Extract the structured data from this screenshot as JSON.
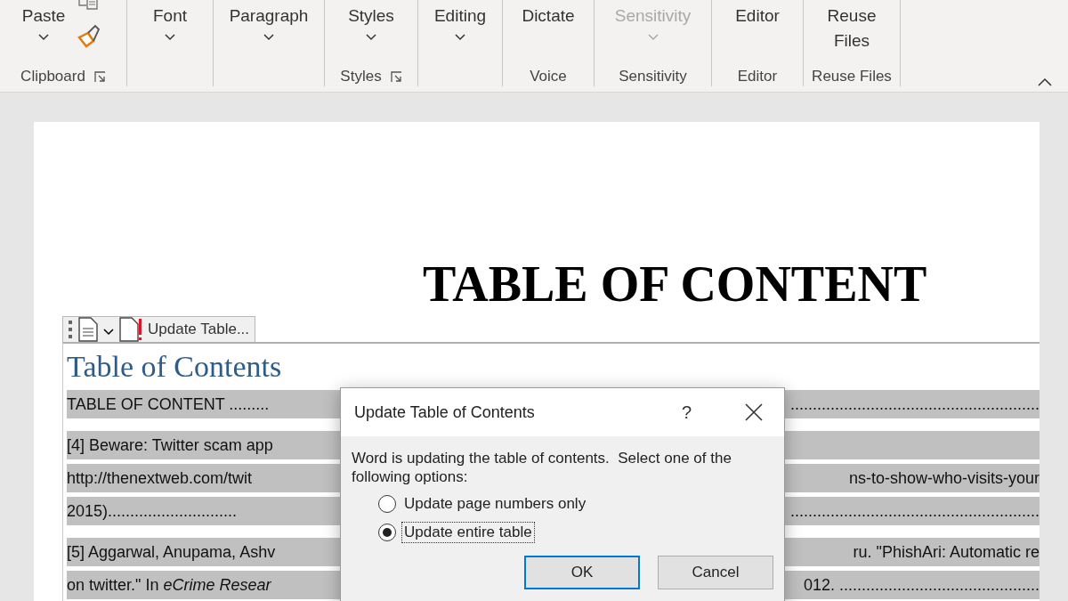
{
  "ribbon": {
    "groups": [
      {
        "kind": "clipboard",
        "label": "Clipboard",
        "launcher": true,
        "buttons": [
          {
            "label": "Paste",
            "dropdown": true,
            "disabled": false
          }
        ]
      },
      {
        "kind": "standard",
        "launcher": false,
        "buttons": [
          {
            "label": "Font",
            "dropdown": true,
            "disabled": false
          }
        ]
      },
      {
        "kind": "standard",
        "launcher": false,
        "buttons": [
          {
            "label": "Paragraph",
            "dropdown": true,
            "disabled": false
          }
        ]
      },
      {
        "kind": "standard",
        "label": "Styles",
        "launcher": true,
        "buttons": [
          {
            "label": "Styles",
            "dropdown": true,
            "disabled": false
          }
        ]
      },
      {
        "kind": "standard",
        "launcher": false,
        "buttons": [
          {
            "label": "Editing",
            "dropdown": true,
            "disabled": false
          }
        ]
      },
      {
        "kind": "standard",
        "label": "Voice",
        "launcher": false,
        "buttons": [
          {
            "label": "Dictate",
            "dropdown": false,
            "disabled": false
          }
        ]
      },
      {
        "kind": "standard",
        "label": "Sensitivity",
        "launcher": false,
        "buttons": [
          {
            "label": "Sensitivity",
            "dropdown": true,
            "disabled": true
          }
        ]
      },
      {
        "kind": "standard",
        "label": "Editor",
        "launcher": false,
        "buttons": [
          {
            "label": "Editor",
            "dropdown": false,
            "disabled": false
          }
        ]
      },
      {
        "kind": "standard",
        "label": "Reuse Files",
        "launcher": false,
        "buttons": [
          {
            "label": "Reuse Files",
            "dropdown": false,
            "disabled": false
          }
        ]
      }
    ]
  },
  "document": {
    "title": "TABLE OF CONTENT",
    "content_control": {
      "tab_button": "Update Table...",
      "heading": "Table of Contents",
      "entries": [
        {
          "lines": [
            {
              "left": "TABLE OF CONTENT .........",
              "right": "........................................................"
            }
          ]
        },
        {
          "lines": [
            {
              "left": "[4] Beware: Twitter scam app"
            },
            {
              "left": "http://thenextweb.com/twit",
              "right": "ns-to-show-who-visits-your"
            },
            {
              "left": "2015).............................",
              "right": "........................................................"
            }
          ]
        },
        {
          "lines": [
            {
              "left": "[5] Aggarwal, Anupama, Ashv",
              "right": "ru. \"PhishAri: Automatic re"
            },
            {
              "left": "on twitter.\" In *eCrime Resear*",
              "right": "012. ............................................."
            }
          ]
        }
      ]
    }
  },
  "dialog": {
    "title": "Update Table of Contents",
    "help": "?",
    "message": "Word is updating the table of contents.  Select one of the following options:",
    "options": [
      {
        "label": "Update page numbers only",
        "selected": false
      },
      {
        "label": "Update entire table",
        "selected": true
      }
    ],
    "buttons": [
      {
        "label": "OK",
        "default": true
      },
      {
        "label": "Cancel",
        "default": false
      }
    ]
  }
}
